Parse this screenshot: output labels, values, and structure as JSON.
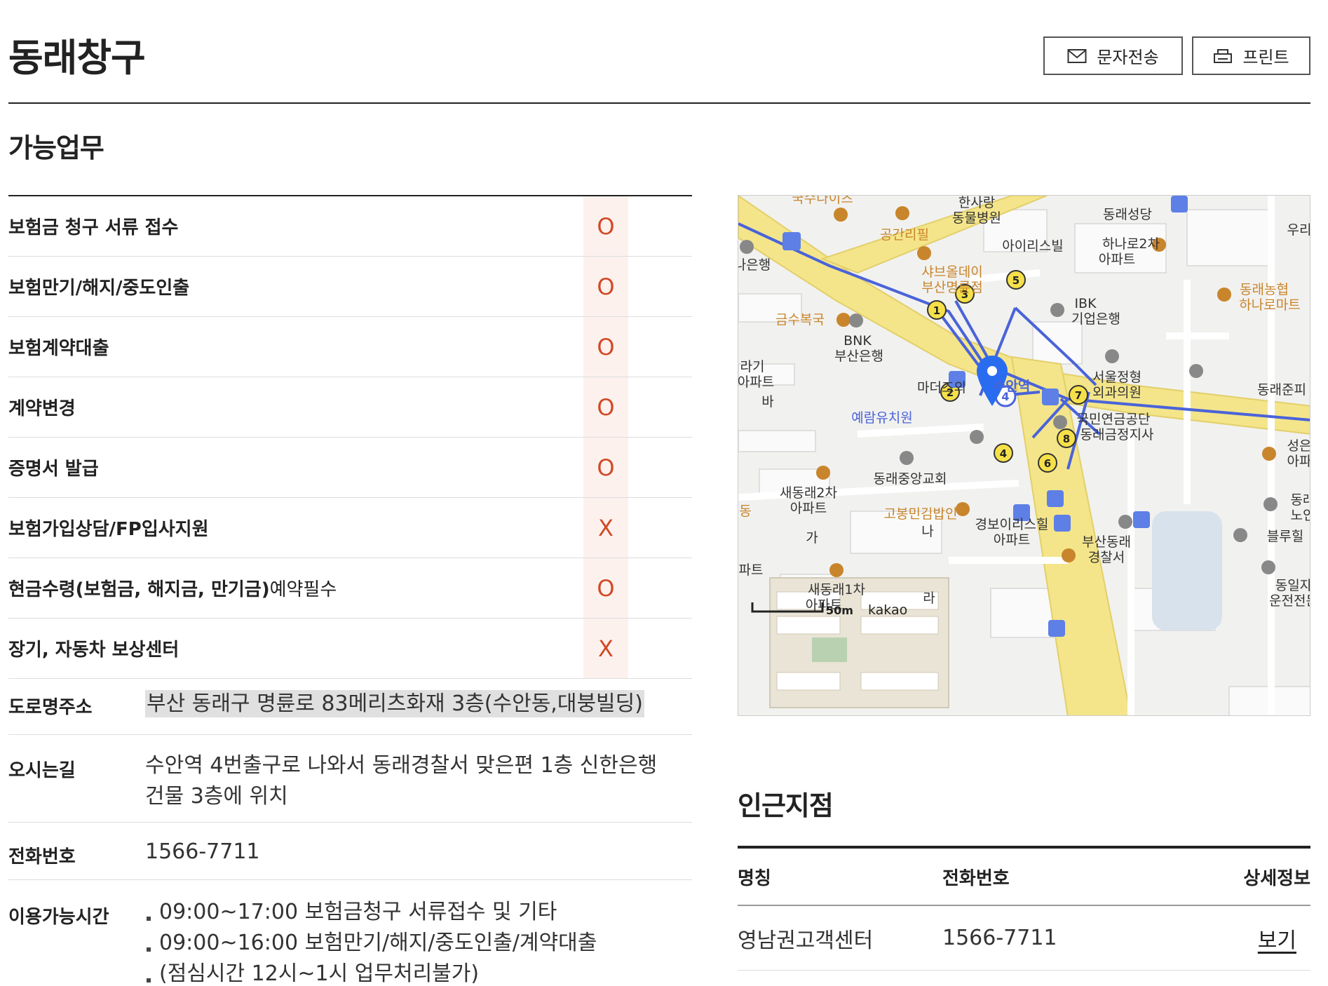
{
  "page": {
    "title": "동래창구"
  },
  "toolbar": {
    "sms_label": "문자전송",
    "print_label": "프린트"
  },
  "services": {
    "title": "가능업무",
    "items": [
      {
        "name": "보험금 청구 서류 접수",
        "name_suffix": "",
        "mark": "O"
      },
      {
        "name": "보험만기/해지/중도인출",
        "name_suffix": "",
        "mark": "O"
      },
      {
        "name": "보험계약대출",
        "name_suffix": "",
        "mark": "O"
      },
      {
        "name": "계약변경",
        "name_suffix": "",
        "mark": "O"
      },
      {
        "name": "증명서 발급",
        "name_suffix": "",
        "mark": "O"
      },
      {
        "name": "보험가입상담/FP입사지원",
        "name_suffix": "",
        "mark": "X"
      },
      {
        "name": "현금수령(보험금, 해지금, 만기금)",
        "name_suffix": "예약필수",
        "mark": "O"
      },
      {
        "name": "장기, 자동차 보상센터",
        "name_suffix": "",
        "mark": "X"
      }
    ]
  },
  "info": {
    "address_label": "도로명주소",
    "address": "부산 동래구 명륜로 83메리츠화재 3층(수안동,대붕빌딩)",
    "directions_label": "오시는길",
    "directions_line1": "수안역 4번출구로 나와서 동래경찰서 맞은편 1층 신한은행",
    "directions_line2": "건물 3층에 위치",
    "phone_label": "전화번호",
    "phone": "1566-7711",
    "hours_label": "이용가능시간",
    "hours": [
      "09:00~17:00 보험금청구 서류접수 및 기타",
      "09:00~16:00 보험만기/해지/중도인출/계약대출",
      "(점심시간 12시~1시 업무처리불가)"
    ]
  },
  "map": {
    "labels": {
      "l1": "한사랑",
      "l2": "동물병원",
      "l3": "동래성당",
      "l4": "우리",
      "l5": "공간리필",
      "l6": "아이리스빌",
      "l7": "하나로2차",
      "l8": "아파트",
      "l9": "나은행",
      "l10": "샤브올데이",
      "l11": "부산명륜점",
      "l12": "동래농협",
      "l13": "하나로마트",
      "l14": "IBK",
      "l15": "기업은행",
      "l16": "금수복국",
      "l17": "BNK",
      "l18": "부산은행",
      "l19": "라기",
      "l20": "아파트",
      "l21": "서울정형",
      "l22": "외과의원",
      "l23": "동래준피",
      "l24": "마더즈의",
      "l25": "수안역",
      "l26": "바",
      "l27": "예람유치원",
      "l28": "국민연금공단",
      "l29": "동래금정지사",
      "l30": "성은",
      "l31": "아파",
      "l32": "동래중앙교회",
      "l33": "새동래2차",
      "l34": "아파트",
      "l35": "동래",
      "l36": "노인",
      "l37": "고봉민김밥인",
      "l38": "경보이리스힐",
      "l39": "아파트",
      "l40": "블루힐",
      "l41": "부산동래",
      "l42": "경찰서",
      "l43": "동",
      "l44": "가",
      "l45": "나",
      "l46": "파트",
      "l47": "새동래1차",
      "l48": "아파트",
      "l49": "라",
      "l50": "동일자",
      "l51": "운전전문",
      "l52": "국수나이츠"
    },
    "scale_label": "50m",
    "brand": "kakao",
    "exit_numbers": [
      "1",
      "2",
      "3",
      "4",
      "5",
      "6",
      "7",
      "8"
    ],
    "station_marker": "4",
    "colors": {
      "road": "#f4e58a",
      "route": "#4a63d9",
      "poi": "#c8852b",
      "marker": "#2a6cf0"
    }
  },
  "nearby": {
    "title": "인근지점",
    "headers": {
      "name": "명칭",
      "phone": "전화번호",
      "detail": "상세정보"
    },
    "rows": [
      {
        "name": "영남권고객센터",
        "phone": "1566-7711",
        "detail": "보기"
      }
    ]
  }
}
